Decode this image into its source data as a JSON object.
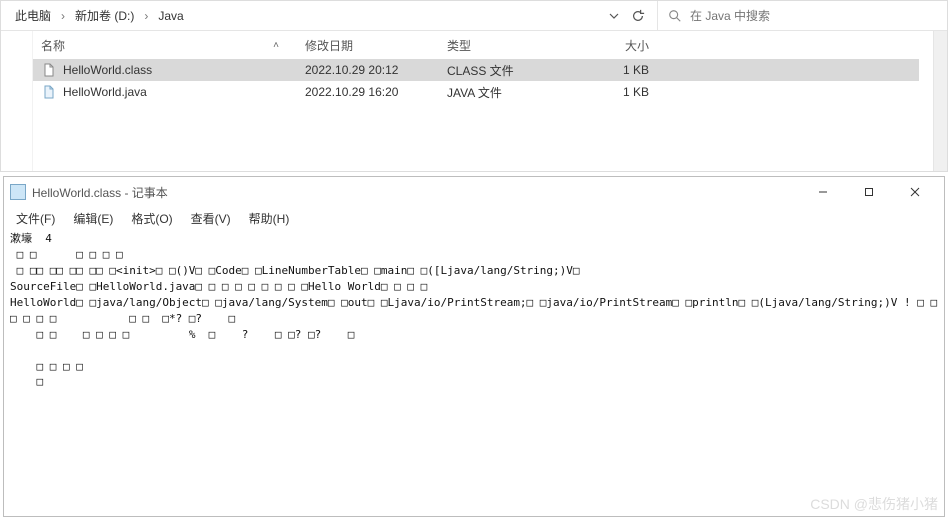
{
  "explorer": {
    "breadcrumbs": [
      "此电脑",
      "新加卷 (D:)",
      "Java"
    ],
    "search_placeholder": "在 Java 中搜索",
    "columns": {
      "name": "名称",
      "date": "修改日期",
      "type": "类型",
      "size": "大小"
    },
    "files": [
      {
        "name": "HelloWorld.class",
        "date": "2022.10.29 20:12",
        "type": "CLASS 文件",
        "size": "1 KB",
        "selected": true
      },
      {
        "name": "HelloWorld.java",
        "date": "2022.10.29 16:20",
        "type": "JAVA 文件",
        "size": "1 KB",
        "selected": false
      }
    ]
  },
  "notepad": {
    "title": "HelloWorld.class - 记事本",
    "menus": {
      "file": "文件(F)",
      "edit": "编辑(E)",
      "format": "格式(O)",
      "view": "查看(V)",
      "help": "帮助(H)"
    },
    "content_lines": [
      "漱壕  4",
      " □ □      □ □ □ □",
      " □ □□ □□ □□ □□ □<init>□ □()V□ □Code□ □LineNumberTable□ □main□ □([Ljava/lang/String;)V□",
      "SourceFile□ □HelloWorld.java□ □ □ □ □ □ □ □ □Hello World□ □ □ □",
      "HelloWorld□ □java/lang/Object□ □java/lang/System□ □out□ □Ljava/io/PrintStream;□ □java/io/PrintStream□ □println□ □(Ljava/lang/String;)V ! □ □      □ □ □ □           □ □  □*? □?    □",
      "    □ □    □ □ □ □         %  □    ?    □ □? □?    □",
      "",
      "    □ □ □ □",
      "    □"
    ]
  },
  "watermark": "CSDN @悲伤猪小猪"
}
